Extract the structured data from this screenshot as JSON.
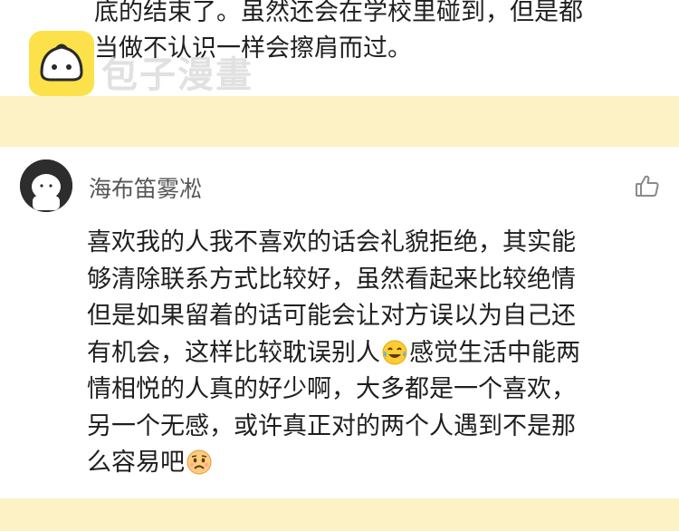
{
  "previous_comment": {
    "line1": "底的结束了。虽然还会在学校里碰到，但是都",
    "line2": "当做不认识一样会擦肩而过。"
  },
  "watermark": {
    "text": "包子漫畫"
  },
  "comment": {
    "username": "海布笛雾凇",
    "body_lines": [
      "喜欢我的人我不喜欢的话会礼貌拒绝，其实能",
      "够清除联系方式比较好，虽然看起来比较绝情",
      "但是如果留着的话可能会让对方误以为自己还",
      "有机会，这样比较耽误别人",
      "感觉生活中能两",
      "情相悦的人真的好少啊，大多都是一个喜欢，",
      "另一个无感，或许真正对的两个人遇到不是那",
      "么容易吧"
    ],
    "emojis": [
      "face-with-tears-of-joy-icon",
      "worried-face-icon"
    ]
  },
  "colors": {
    "band": "#fdf1c6",
    "logo_yellow": "#fce14a",
    "text": "#1f1f1f",
    "username": "#555555"
  }
}
